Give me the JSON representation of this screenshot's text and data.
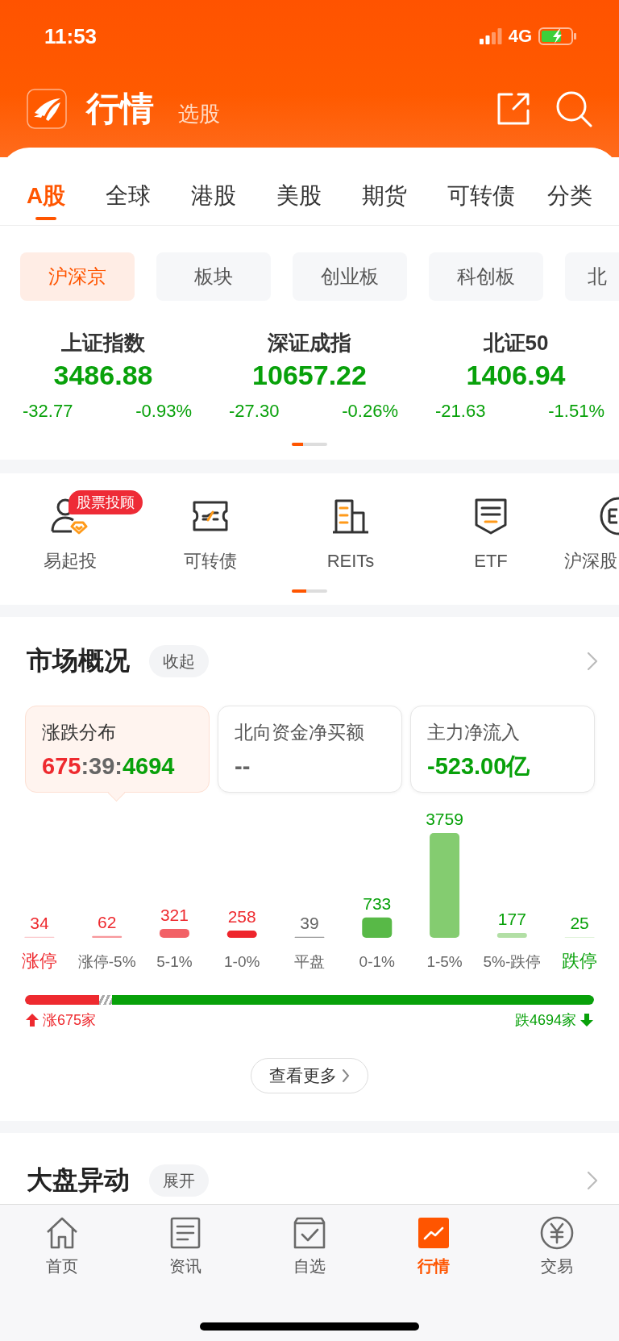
{
  "status_bar": {
    "time": "11:53",
    "network": "4G"
  },
  "header": {
    "title": "行情",
    "subtitle_link": "选股"
  },
  "market_tabs": [
    {
      "label": "A股",
      "selected": true
    },
    {
      "label": "全球",
      "selected": false
    },
    {
      "label": "港股",
      "selected": false
    },
    {
      "label": "美股",
      "selected": false
    },
    {
      "label": "期货",
      "selected": false
    },
    {
      "label": "可转债",
      "selected": false
    }
  ],
  "category_button": "分类",
  "region_chips": [
    {
      "label": "沪深京",
      "selected": true
    },
    {
      "label": "板块",
      "selected": false
    },
    {
      "label": "创业板",
      "selected": false
    },
    {
      "label": "科创板",
      "selected": false
    },
    {
      "label": "北",
      "selected": false
    }
  ],
  "indices": [
    {
      "name": "上证指数",
      "value": "3486.88",
      "change": "-32.77",
      "percent": "-0.93%",
      "color": "#08a10a"
    },
    {
      "name": "深证成指",
      "value": "10657.22",
      "change": "-27.30",
      "percent": "-0.26%",
      "color": "#08a10a"
    },
    {
      "name": "北证50",
      "value": "1406.94",
      "change": "-21.63",
      "percent": "-1.51%",
      "color": "#08a10a"
    }
  ],
  "shortcuts": [
    {
      "label": "易起投",
      "kind": "advisor",
      "badge": "股票投顾"
    },
    {
      "label": "可转债",
      "kind": "ticket"
    },
    {
      "label": "REITs",
      "kind": "building"
    },
    {
      "label": "ETF",
      "kind": "shield"
    },
    {
      "label": "沪深股",
      "kind": "circle"
    }
  ],
  "market_overview": {
    "title": "市场概况",
    "toggle": "收起",
    "cards": [
      {
        "label": "涨跌分布",
        "selected": true,
        "value_parts": [
          {
            "text": "675",
            "color": "#ee2a2f"
          },
          {
            "text": ":39:",
            "color": "#666666"
          },
          {
            "text": "4694",
            "color": "#08a10a"
          }
        ]
      },
      {
        "label": "北向资金净买额",
        "selected": false,
        "value_parts": [
          {
            "text": "--",
            "color": "#666666"
          }
        ]
      },
      {
        "label": "主力净流入",
        "selected": false,
        "value_parts": [
          {
            "text": "-523.00亿",
            "color": "#08a10a"
          }
        ]
      }
    ],
    "distribution": {
      "chart_data": {
        "type": "bar",
        "categories": [
          "涨停",
          "涨停-5%",
          "5-1%",
          "1-0%",
          "平盘",
          "0-1%",
          "1-5%",
          "5%-跌停",
          "跌停"
        ],
        "values": [
          34,
          62,
          321,
          258,
          39,
          733,
          3759,
          177,
          25
        ],
        "data_labels": true
      },
      "bars": [
        {
          "color": "#fbc8cb",
          "value_label": {
            "color": "#ee2a2f"
          },
          "emphasis": true
        },
        {
          "color": "#f7979b",
          "value_label": {
            "color": "#ee2a2f"
          },
          "emphasis": false
        },
        {
          "color": "#f26166",
          "value_label": {
            "color": "#ee2a2f"
          },
          "emphasis": false
        },
        {
          "color": "#ee252c",
          "value_label": {
            "color": "#ee2a2f"
          },
          "emphasis": false
        },
        {
          "color": "#9a9a9a",
          "value_label": {
            "color": "#666666"
          },
          "emphasis": false
        },
        {
          "color": "#58b947",
          "value_label": {
            "color": "#08a10a"
          },
          "emphasis": false
        },
        {
          "color": "#84cc70",
          "value_label": {
            "color": "#08a10a"
          },
          "emphasis": false
        },
        {
          "color": "#b2dfa5",
          "value_label": {
            "color": "#08a10a"
          },
          "emphasis": false
        },
        {
          "color": "#d5efcd",
          "value_label": {
            "color": "#08a10a"
          },
          "emphasis": true
        }
      ]
    },
    "breadth": {
      "level": 0.13,
      "rise_label": "涨675家",
      "fall_label": "跌4694家"
    },
    "more_button": "查看更多"
  },
  "market_alerts": {
    "title": "大盘异动",
    "toggle": "展开"
  },
  "bottom_nav": [
    {
      "label": "首页",
      "kind": "home",
      "selected": false
    },
    {
      "label": "资讯",
      "kind": "news",
      "selected": false
    },
    {
      "label": "自选",
      "kind": "watchlist",
      "selected": false
    },
    {
      "label": "行情",
      "kind": "chart",
      "selected": true
    },
    {
      "label": "交易",
      "kind": "trade",
      "selected": false
    }
  ]
}
